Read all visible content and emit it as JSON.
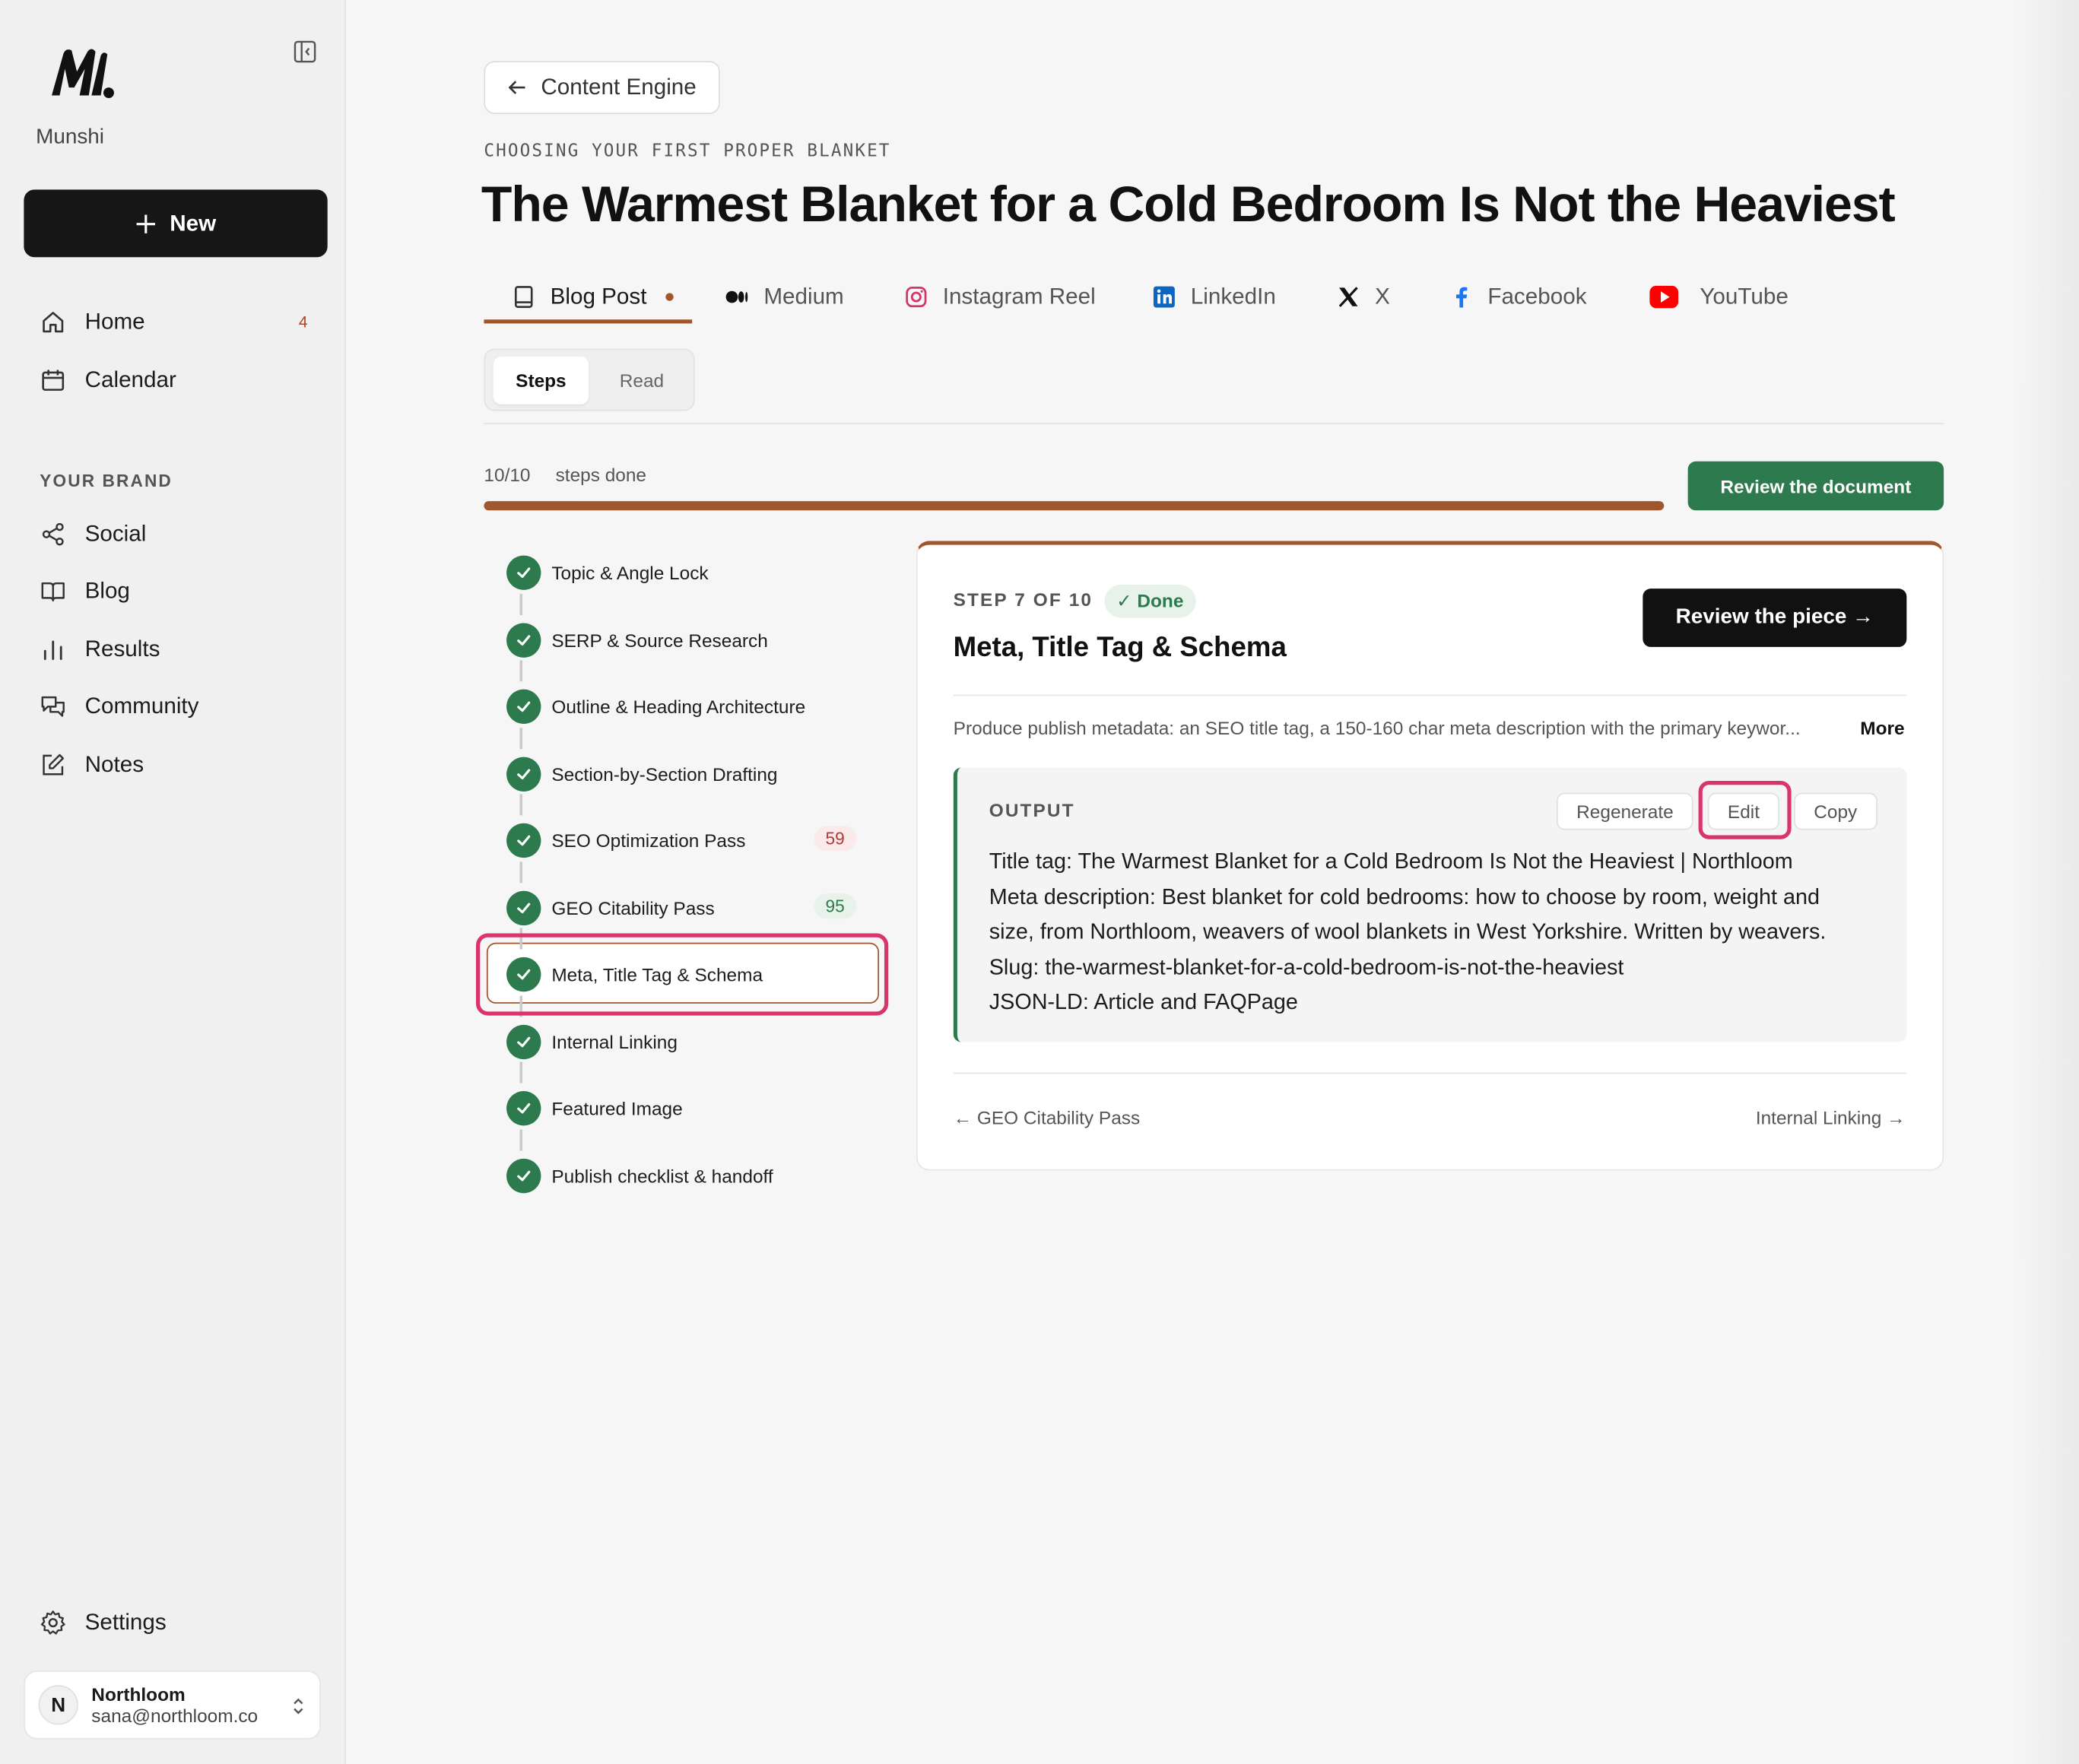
{
  "sidebar": {
    "brand": "Munshi",
    "new_button": "New",
    "nav": [
      {
        "label": "Home",
        "count": "4"
      },
      {
        "label": "Calendar"
      }
    ],
    "section_label": "YOUR BRAND",
    "brand_nav": [
      {
        "label": "Social"
      },
      {
        "label": "Blog"
      },
      {
        "label": "Results"
      },
      {
        "label": "Community"
      },
      {
        "label": "Notes"
      }
    ],
    "settings": "Settings",
    "account": {
      "initial": "N",
      "name": "Northloom",
      "email": "sana@northloom.co"
    }
  },
  "header": {
    "back_label": "Content Engine",
    "eyebrow": "CHOOSING YOUR FIRST PROPER BLANKET",
    "title": "The Warmest Blanket for a Cold Bedroom Is Not the Heaviest"
  },
  "tabs": [
    {
      "label": "Blog Post",
      "icon": "book-icon",
      "active": true
    },
    {
      "label": "Medium",
      "icon": "medium-icon"
    },
    {
      "label": "Instagram Reel",
      "icon": "instagram-icon"
    },
    {
      "label": "LinkedIn",
      "icon": "linkedin-icon"
    },
    {
      "label": "X",
      "icon": "x-icon"
    },
    {
      "label": "Facebook",
      "icon": "facebook-icon"
    },
    {
      "label": "YouTube",
      "icon": "youtube-icon"
    }
  ],
  "view_toggle": {
    "steps": "Steps",
    "read": "Read",
    "selected": "Steps"
  },
  "progress": {
    "count": "10/10",
    "label": "steps done",
    "fraction": 1.0,
    "review_button": "Review the document"
  },
  "steps": [
    {
      "label": "Topic & Angle Lock"
    },
    {
      "label": "SERP & Source Research"
    },
    {
      "label": "Outline & Heading Architecture"
    },
    {
      "label": "Section-by-Section Drafting"
    },
    {
      "label": "SEO Optimization Pass",
      "score": "59"
    },
    {
      "label": "GEO Citability Pass",
      "score": "95"
    },
    {
      "label": "Meta, Title Tag & Schema"
    },
    {
      "label": "Internal Linking"
    },
    {
      "label": "Featured Image"
    },
    {
      "label": "Publish checklist & handoff"
    }
  ],
  "detail": {
    "step_num": "STEP 7 OF 10",
    "status": "✓ Done",
    "title": "Meta, Title Tag & Schema",
    "review_button": "Review the piece →",
    "description": "Produce publish metadata: an SEO title tag, a 150-160 char meta description with the primary keywor...",
    "more": "More",
    "output_label": "OUTPUT",
    "buttons": {
      "regenerate": "Regenerate",
      "edit": "Edit",
      "copy": "Copy"
    },
    "output_lines": [
      "Title tag: The Warmest Blanket for a Cold Bedroom Is Not the Heaviest | Northloom",
      "Meta description: Best blanket for cold bedrooms: how to choose by room, weight and",
      "size, from Northloom, weavers of wool blankets in West Yorkshire. Written by weavers.",
      "Slug: the-warmest-blanket-for-a-cold-bedroom-is-not-the-heaviest",
      "JSON-LD: Article and FAQPage"
    ],
    "prev": "← GEO Citability Pass",
    "next": "Internal Linking →"
  },
  "colors": {
    "accent": "#a0572d",
    "success": "#2c7a4e",
    "annotation": "#d9346b"
  }
}
